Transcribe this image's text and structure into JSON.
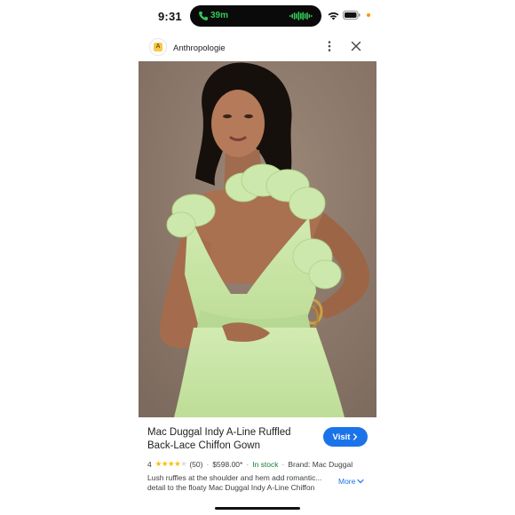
{
  "status_bar": {
    "time": "9:31",
    "call_duration": "39m",
    "call_color": "#34c759",
    "icons": [
      "phone-icon",
      "waveform-icon",
      "wifi-icon",
      "battery-icon"
    ]
  },
  "header": {
    "site_logo_letter": "A",
    "site_name": "Anthropologie",
    "icons": [
      "more-vert-icon",
      "close-icon"
    ]
  },
  "product": {
    "image_alt": "product-photo",
    "title": "Mac Duggal Indy A-Line Ruffled Back-Lace Chiffon Gown",
    "visit_label": "Visit",
    "rating": "4",
    "stars_filled": 4,
    "stars_total": 5,
    "reviews": "(50)",
    "price": "$598.00*",
    "stock": "In stock",
    "brand": "Brand: Mac Duggal",
    "description": "Lush ruffles at the shoulder and hem add romantic... detail to the floaty Mac Duggal Indy A-Line Chiffon",
    "more_label": "More",
    "separator": "·"
  },
  "colors": {
    "accent": "#1a73e8",
    "in_stock": "#188038",
    "star": "#fbbc04",
    "dress": "#c8e5a6",
    "backdrop": "#8f7b6e"
  }
}
